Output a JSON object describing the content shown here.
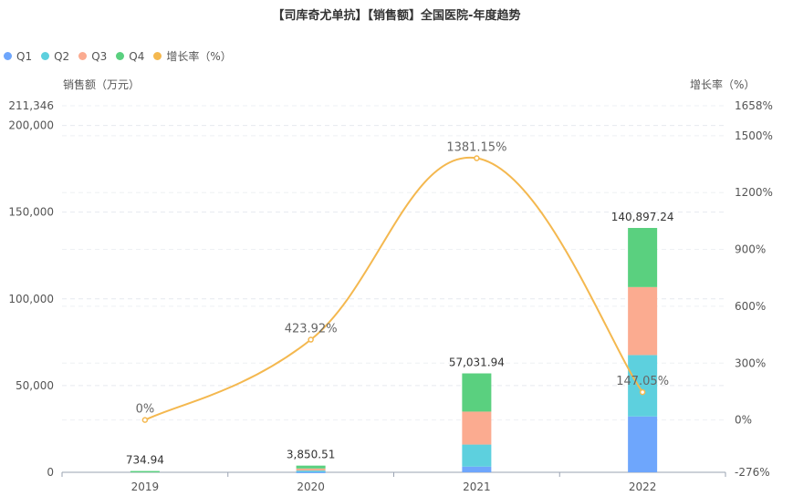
{
  "chart_data": {
    "type": "bar",
    "title": "【司库奇尤单抗】【销售额】全国医院-年度趋势",
    "ylabel": "销售额（万元）",
    "y2label": "增长率（%）",
    "categories": [
      "2019",
      "2020",
      "2021",
      "2022"
    ],
    "stacked": true,
    "series": [
      {
        "name": "Q1",
        "color": "#6ea6fc",
        "values": [
          0,
          300,
          3300,
          32200
        ]
      },
      {
        "name": "Q2",
        "color": "#5dd0de",
        "values": [
          0,
          700,
          12700,
          35400
        ]
      },
      {
        "name": "Q3",
        "color": "#fbab90",
        "values": [
          0,
          1200,
          19000,
          39200
        ]
      },
      {
        "name": "Q4",
        "color": "#5ad07f",
        "values": [
          734.94,
          1650.51,
          22031.94,
          34097.24
        ]
      }
    ],
    "totals": [
      734.94,
      3850.51,
      57031.94,
      140897.24
    ],
    "total_labels": [
      "734.94",
      "3,850.51",
      "57,031.94",
      "140,897.24"
    ],
    "growth": {
      "name": "增长率（%）",
      "color": "#f4b84f",
      "values": [
        0,
        423.92,
        1381.15,
        147.05
      ],
      "labels": [
        "0%",
        "423.92%",
        "1381.15%",
        "147.05%"
      ]
    },
    "ylim": [
      0,
      211346
    ],
    "yticks": [
      0,
      50000,
      100000,
      150000,
      200000,
      211346
    ],
    "ytick_labels": [
      "0",
      "50,000",
      "100,000",
      "150,000",
      "200,000",
      "211,346"
    ],
    "y2lim": [
      -276,
      1658
    ],
    "y2ticks": [
      -276,
      0,
      300,
      600,
      900,
      1200,
      1500,
      1658
    ],
    "y2tick_labels": [
      "-276%",
      "0%",
      "300%",
      "600%",
      "900%",
      "1200%",
      "1500%",
      "1658%"
    ],
    "grid": true,
    "legend_position": "top-left"
  }
}
